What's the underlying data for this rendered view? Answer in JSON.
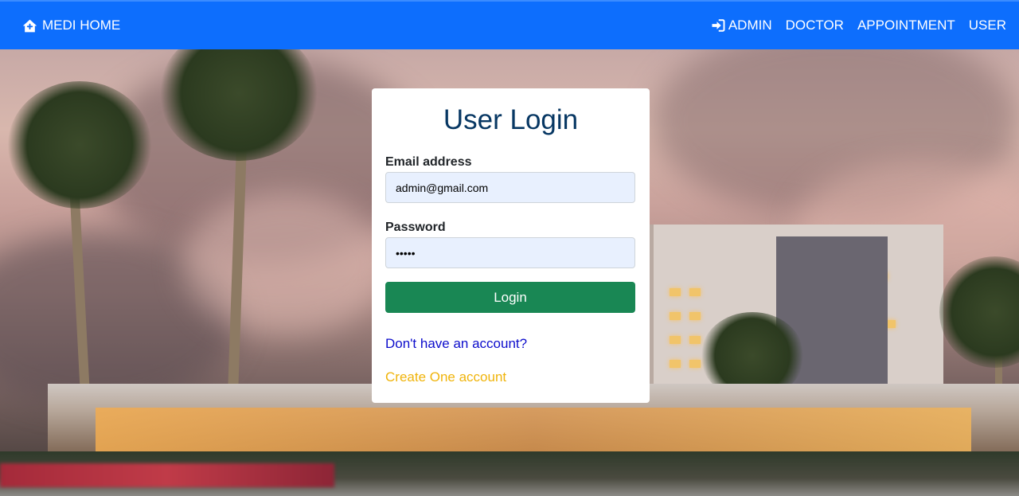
{
  "navbar": {
    "brand_icon": "home-icon",
    "brand_label": "MEDI HOME",
    "links": [
      {
        "label": "ADMIN",
        "icon": "sign-in-icon"
      },
      {
        "label": "DOCTOR"
      },
      {
        "label": "APPOINTMENT"
      },
      {
        "label": "USER"
      }
    ],
    "bg_color": "#0d6efd"
  },
  "login": {
    "title": "User Login",
    "email_label": "Email address",
    "email_value": "admin@gmail.com",
    "password_label": "Password",
    "password_value": "admin",
    "button_label": "Login",
    "no_account_text": "Don't have an account?",
    "create_account_text": "Create One account",
    "button_color": "#198754",
    "title_color": "#073763"
  }
}
